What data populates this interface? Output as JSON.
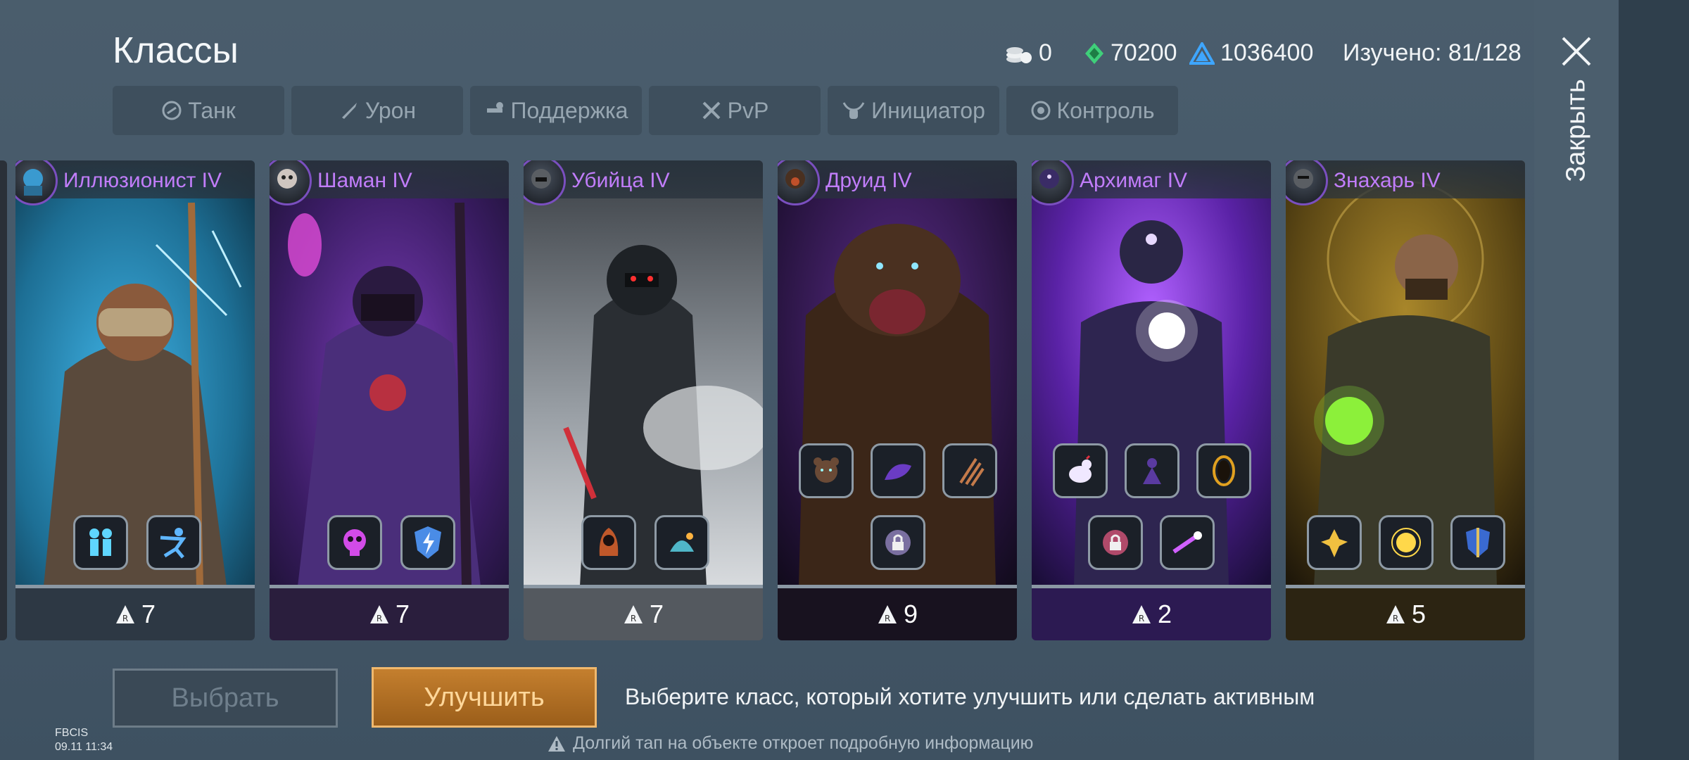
{
  "header": {
    "title": "Классы",
    "resources": [
      {
        "icon": "stacked-coins-icon",
        "value": "0"
      },
      {
        "icon": "green-crystal-icon",
        "value": "70200"
      },
      {
        "icon": "blue-triangle-icon",
        "value": "1036400"
      }
    ],
    "studied": "Изучено: 81/128"
  },
  "close": {
    "label": "Закрыть"
  },
  "tabs": [
    "Танк",
    "Урон",
    "Поддержка",
    "PvP",
    "Инициатор",
    "Контроль"
  ],
  "cards": [
    {
      "name": "Иллюзионист IV",
      "rank": "7"
    },
    {
      "name": "Шаман IV",
      "rank": "7"
    },
    {
      "name": "Убийца IV",
      "rank": "7"
    },
    {
      "name": "Друид IV",
      "rank": "9"
    },
    {
      "name": "Архимаг IV",
      "rank": "2"
    },
    {
      "name": "Знахарь IV",
      "rank": "5"
    }
  ],
  "buttons": {
    "select": "Выбрать",
    "upgrade": "Улучшить"
  },
  "hint": "Выберите класс, который хотите улучшить или сделать активным",
  "note": "Долгий тап на объекте откроет подробную информацию",
  "watermark": {
    "line1": "FBCIS",
    "line2": "09.11 11:34"
  },
  "colors": {
    "class_name": "#c17dfa",
    "upgrade_button": "#c47f2e",
    "background": "#46596a"
  }
}
